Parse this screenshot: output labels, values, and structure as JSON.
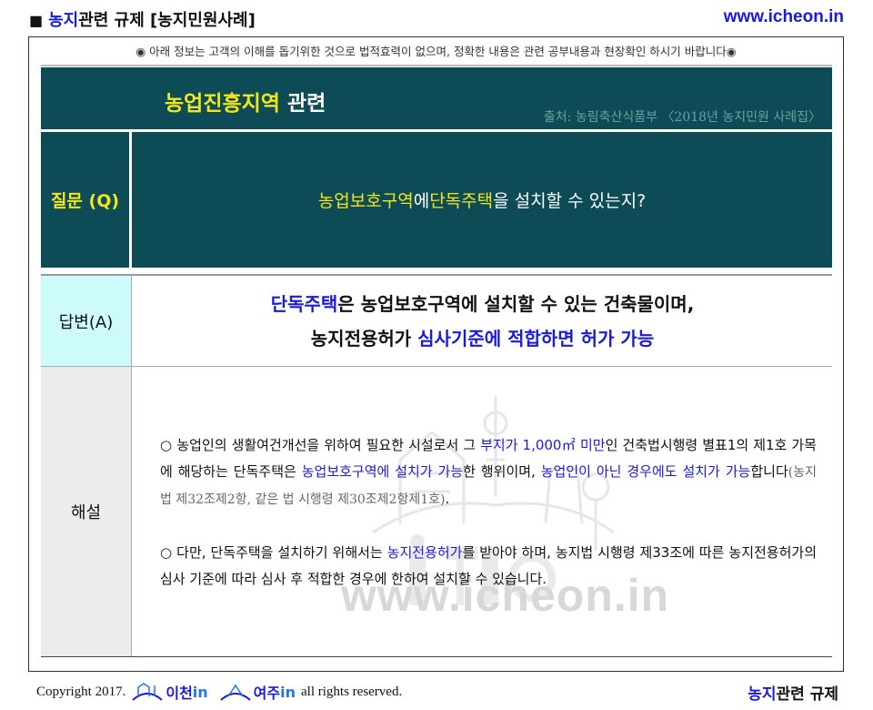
{
  "header": {
    "bullet": "■",
    "title_accent": "농지",
    "title_rest": "관련 규제 [농지민원사례]",
    "site": "www.icheon.in"
  },
  "notice": "◉ 아래 정보는 고객의 이해를 돕기위한 것으로 법적효력이 없으며, 정확한 내용은 관련 공부내용과 현장확인 하시기 바랍니다◉",
  "section": {
    "title_accent": "농업진흥지역",
    "title_rest": " 관련",
    "source": "출처: 농림축산식품부 〈2018년 농지민원 사례집〉"
  },
  "question": {
    "label": "질문 (Q)",
    "part1": "농업보호구역",
    "part2": "에 ",
    "part3": "단독주택",
    "part4": "을 설치할 수 있는지?"
  },
  "answer": {
    "label": "답변(A)",
    "line1_accent": "단독주택",
    "line1_rest": "은 농업보호구역에 설치할 수 있는 건축물이며,",
    "line2_start": "농지전용허가 ",
    "line2_accent": "심사기준에 적합하면 허가 가능"
  },
  "explanation": {
    "label": "해설",
    "p1": {
      "t1": "○ 농업인의 생활여건개선을 위하여 필요한 시설로서 그 ",
      "b1": "부지가 1,000㎡ 미만",
      "t2": "인  건축법시행령  별표1의 제1호 가목에 해당하는 단독주택은 ",
      "b2": "농업보호구역에 설치가 가능",
      "t3": "한 행위이며, ",
      "b3": "농업인이 아닌 경우에도 설치가 가능",
      "t4": "합니다",
      "law": "(농지법  제32조제2항, 같은 법  시행령 제30조제2항제1호)",
      "end": "."
    },
    "p2": {
      "t1": "○ 다만, 단독주택을 설치하기 위해서는 ",
      "b1": "농지전용허가",
      "t2": "를 받아야 하며,  농지법 시행령  제33조에 따른 농지전용허가의 심사 기준에 따라 심사 후 적합한 경우에 한하여 설치할 수 있습니다."
    }
  },
  "watermark": {
    "text": "www.icheon.in"
  },
  "footer": {
    "copyright": "Copyright 2017.",
    "logo1": "이천",
    "logo2": "여주",
    "logo_suffix": "in",
    "rights": "all rights reserved.",
    "right_accent": "농지",
    "right_rest": "관련 규제"
  },
  "colors": {
    "teal": "#0d4c56",
    "yellow": "#f5e61a",
    "blue": "#1a1adb",
    "answer_label_bg": "#cdfbfb",
    "explanation_label_bg": "#ececec"
  }
}
